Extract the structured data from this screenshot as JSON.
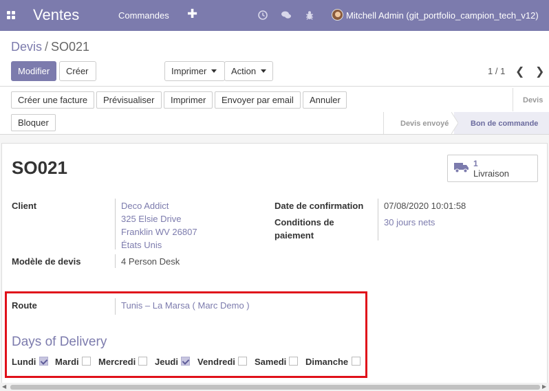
{
  "navbar": {
    "brand": "Ventes",
    "menu_orders": "Commandes",
    "plus": "✚",
    "user": "Mitchell Admin (git_portfolio_campion_tech_v12)"
  },
  "breadcrumb": {
    "parent": "Devis",
    "separator": "/",
    "current": "SO021"
  },
  "actions": {
    "edit": "Modifier",
    "create": "Créer",
    "print": "Imprimer",
    "action": "Action"
  },
  "pager": {
    "value": "1 / 1",
    "prev": "❮",
    "next": "❯"
  },
  "header_buttons": {
    "create_invoice": "Créer une facture",
    "preview": "Prévisualiser",
    "print": "Imprimer",
    "send_email": "Envoyer par email",
    "cancel": "Annuler",
    "lock": "Bloquer"
  },
  "statusbar": {
    "quotation": "Devis",
    "quotation_sent": "Devis envoyé",
    "sales_order": "Bon de commande",
    "active": "Bon de commande"
  },
  "record": {
    "name": "SO021",
    "smart_button": {
      "value": "1",
      "label": "Livraison",
      "icon": "truck-icon"
    },
    "client_label": "Client",
    "client_lines": [
      "Deco Addict",
      "325 Elsie Drive",
      "Franklin WV 26807",
      "États Unis"
    ],
    "template_label": "Modèle de devis",
    "template_value": "4 Person Desk",
    "confirmation_label": "Date de confirmation",
    "confirmation_value": "07/08/2020 10:01:58",
    "terms_label_1": "Conditions de",
    "terms_label_2": "paiement",
    "terms_value": "30 jours nets",
    "route_label": "Route",
    "route_value": "Tunis – La Marsa ( Marc Demo )"
  },
  "delivery": {
    "title": "Days of Delivery",
    "days": [
      {
        "label": "Lundi",
        "checked": true
      },
      {
        "label": "Mardi",
        "checked": false
      },
      {
        "label": "Mercredi",
        "checked": false
      },
      {
        "label": "Jeudi",
        "checked": true
      },
      {
        "label": "Vendredi",
        "checked": false
      },
      {
        "label": "Samedi",
        "checked": false
      },
      {
        "label": "Dimanche",
        "checked": false
      }
    ]
  },
  "colors": {
    "brand": "#7c7bad",
    "highlight_border": "#e0101a"
  }
}
